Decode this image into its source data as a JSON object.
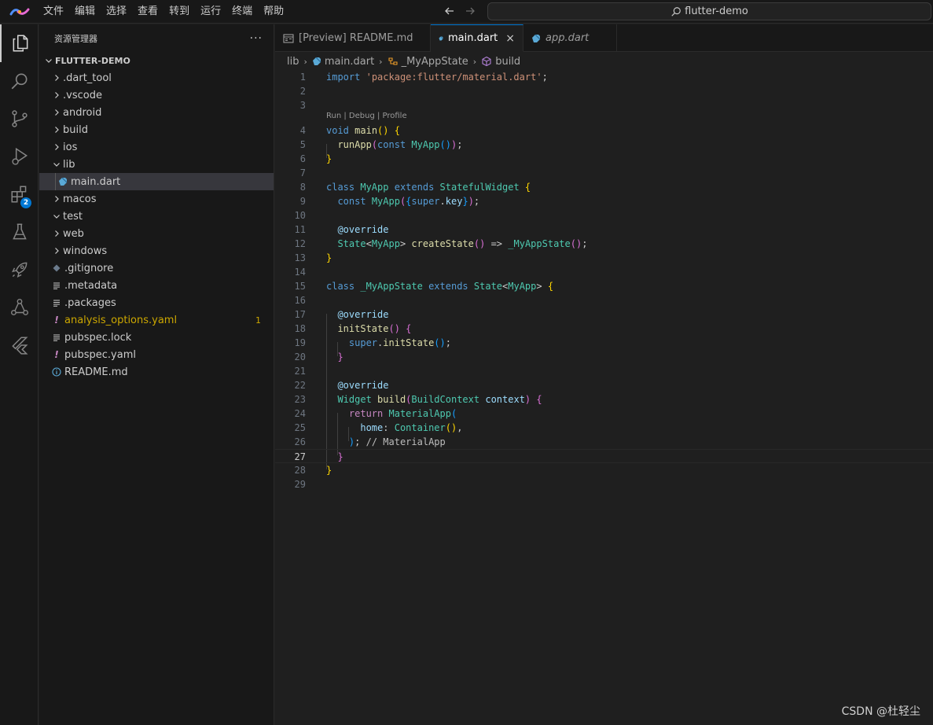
{
  "menu": [
    "文件",
    "编辑",
    "选择",
    "查看",
    "转到",
    "运行",
    "终端",
    "帮助"
  ],
  "search": {
    "label": "flutter-demo"
  },
  "activity": {
    "extensions_badge": "2"
  },
  "sidebar": {
    "title": "资源管理器",
    "more": "···",
    "root": "FLUTTER-DEMO",
    "items": [
      {
        "label": ".dart_tool"
      },
      {
        "label": ".vscode"
      },
      {
        "label": "android"
      },
      {
        "label": "build"
      },
      {
        "label": "ios"
      },
      {
        "label": "lib"
      },
      {
        "label": "main.dart"
      },
      {
        "label": "macos"
      },
      {
        "label": "test"
      },
      {
        "label": "web"
      },
      {
        "label": "windows"
      },
      {
        "label": ".gitignore"
      },
      {
        "label": ".metadata"
      },
      {
        "label": ".packages"
      },
      {
        "label": "analysis_options.yaml",
        "badge": "1"
      },
      {
        "label": "pubspec.lock"
      },
      {
        "label": "pubspec.yaml"
      },
      {
        "label": "README.md"
      }
    ]
  },
  "tabs": [
    {
      "label": "[Preview] README.md"
    },
    {
      "label": "main.dart"
    },
    {
      "label": "app.dart"
    }
  ],
  "breadcrumb": [
    "lib",
    "main.dart",
    "_MyAppState",
    "build"
  ],
  "editor": {
    "codelens": "Run | Debug | Profile",
    "line_numbers": [
      "1",
      "2",
      "3",
      "4",
      "5",
      "6",
      "7",
      "8",
      "9",
      "10",
      "11",
      "12",
      "13",
      "14",
      "15",
      "16",
      "17",
      "18",
      "19",
      "20",
      "21",
      "22",
      "23",
      "24",
      "25",
      "26",
      "27",
      "28",
      "29"
    ],
    "tokens": {
      "l1": [
        "import",
        "'package:flutter/material.dart'",
        ";"
      ],
      "l4": [
        "void",
        "main",
        "()",
        "{"
      ],
      "l5": [
        "runApp",
        "(",
        "const",
        "MyApp",
        "()",
        ")",
        ";"
      ],
      "l6": [
        "}"
      ],
      "l8": [
        "class",
        "MyApp",
        "extends",
        "StatefulWidget",
        "{"
      ],
      "l9": [
        "const",
        "MyApp",
        "(",
        "{",
        "super",
        ".",
        "key",
        "}",
        ")",
        ";"
      ],
      "l11": [
        "@override"
      ],
      "l12": [
        "State",
        "<",
        "MyApp",
        ">",
        "createState",
        "()",
        "=>",
        "_MyAppState",
        "()",
        ";"
      ],
      "l13": [
        "}"
      ],
      "l15": [
        "class",
        "_MyAppState",
        "extends",
        "State",
        "<",
        "MyApp",
        ">",
        "{"
      ],
      "l17": [
        "@override"
      ],
      "l18": [
        "initState",
        "()",
        "{"
      ],
      "l19": [
        "super",
        ".",
        "initState",
        "()",
        ";"
      ],
      "l20": [
        "}"
      ],
      "l22": [
        "@override"
      ],
      "l23": [
        "Widget",
        "build",
        "(",
        "BuildContext",
        "context",
        ")",
        "{"
      ],
      "l24": [
        "return",
        "MaterialApp",
        "("
      ],
      "l25": [
        "home",
        ":",
        "Container",
        "()",
        ","
      ],
      "l26": [
        ")",
        ";",
        "// MaterialApp"
      ],
      "l27": [
        "}"
      ],
      "l28": [
        "}"
      ]
    }
  },
  "watermark": "CSDN @杜轻尘"
}
